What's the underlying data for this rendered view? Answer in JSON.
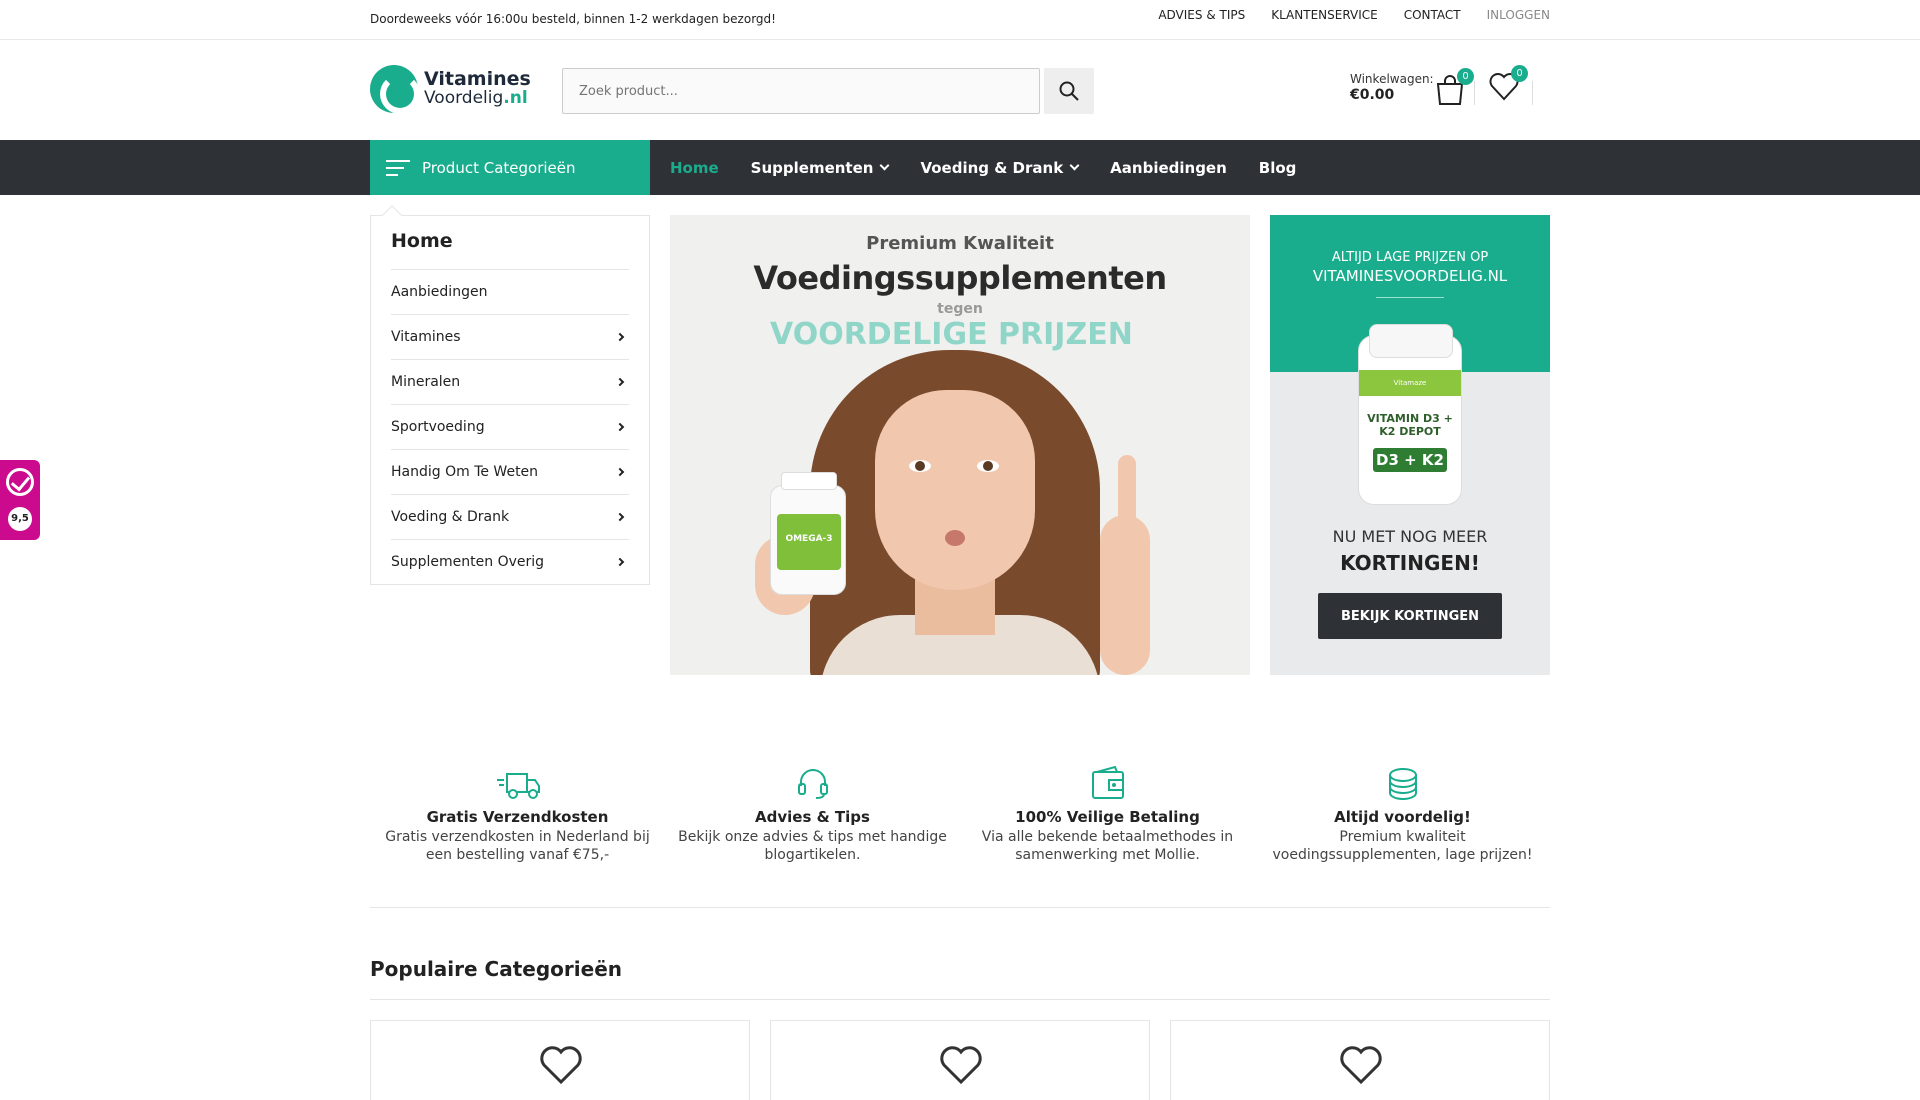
{
  "topbar": {
    "message": "Doordeweeks vóór 16:00u besteld, binnen 1-2 werkdagen bezorgd!",
    "links": [
      "ADVIES & TIPS",
      "KLANTENSERVICE",
      "CONTACT",
      "INLOGGEN"
    ]
  },
  "logo": {
    "line1": "Vitamines",
    "line2_main": "Voordelig",
    "line2_ext": ".nl"
  },
  "search": {
    "placeholder": "Zoek product..."
  },
  "cart": {
    "label": "Winkelwagen:",
    "amount": "€0.00",
    "count": "0"
  },
  "wishlist": {
    "count": "0"
  },
  "nav": {
    "categories_label": "Product Categorieën",
    "items": [
      {
        "label": "Home",
        "active": true
      },
      {
        "label": "Supplementen",
        "dropdown": true
      },
      {
        "label": "Voeding & Drank",
        "dropdown": true
      },
      {
        "label": "Aanbiedingen"
      },
      {
        "label": "Blog"
      }
    ]
  },
  "sidebar": {
    "title": "Home",
    "items": [
      {
        "label": "Aanbiedingen",
        "arrow": false
      },
      {
        "label": "Vitamines",
        "arrow": true
      },
      {
        "label": "Mineralen",
        "arrow": true
      },
      {
        "label": "Sportvoeding",
        "arrow": true
      },
      {
        "label": "Handig Om Te Weten",
        "arrow": true
      },
      {
        "label": "Voeding & Drank",
        "arrow": true
      },
      {
        "label": "Supplementen Overig",
        "arrow": true
      }
    ]
  },
  "hero": {
    "line1": "Premium Kwaliteit",
    "line2": "Voedingssupplementen",
    "line3": "tegen",
    "line4": "VOORDELIGE PRIJZEN",
    "bottle_text": "OMEGA-3"
  },
  "promo": {
    "line1": "ALTIJD LAGE PRIJZEN OP",
    "line2": "VITAMINESVOORDELIG.NL",
    "bottle_brand": "Vitamaze",
    "bottle_text": "VITAMIN D3 + K2 DEPOT",
    "bottle_box": "D3 + K2",
    "line3": "NU MET NOG MEER",
    "line4": "KORTINGEN!",
    "button": "BEKIJK KORTINGEN"
  },
  "features": [
    {
      "icon": "truck-icon",
      "title": "Gratis Verzendkosten",
      "desc": "Gratis verzendkosten in Nederland bij een bestelling vanaf €75,-"
    },
    {
      "icon": "headset-icon",
      "title": "Advies & Tips",
      "desc": "Bekijk onze advies & tips met handige blogartikelen."
    },
    {
      "icon": "wallet-icon",
      "title": "100% Veilige Betaling",
      "desc": "Via alle bekende betaalmethodes in samenwerking met Mollie."
    },
    {
      "icon": "coins-icon",
      "title": "Altijd voordelig!",
      "desc": "Premium kwaliteit voedingssupplementen, lage prijzen!"
    }
  ],
  "popular": {
    "title": "Populaire Categorieën"
  },
  "rating": {
    "score": "9,5"
  },
  "colors": {
    "accent": "#1aad8d",
    "dark": "#2e3136",
    "rating": "#cc0a8e"
  }
}
